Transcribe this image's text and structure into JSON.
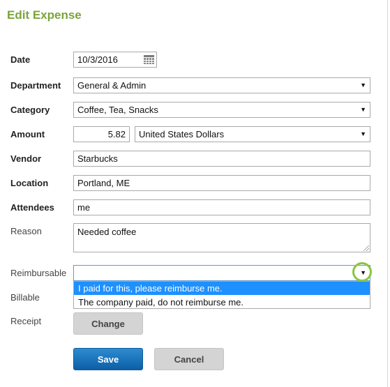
{
  "title": "Edit Expense",
  "form": {
    "date": {
      "label": "Date",
      "value": "10/3/2016",
      "icon": "calendar-icon"
    },
    "department": {
      "label": "Department",
      "value": "General & Admin"
    },
    "category": {
      "label": "Category",
      "value": "Coffee, Tea, Snacks"
    },
    "amount": {
      "label": "Amount",
      "value": "5.82",
      "currency": "United States Dollars"
    },
    "vendor": {
      "label": "Vendor",
      "value": "Starbucks"
    },
    "location": {
      "label": "Location",
      "value": "Portland, ME"
    },
    "attendees": {
      "label": "Attendees",
      "value": "me"
    },
    "reason": {
      "label": "Reason",
      "value": "Needed coffee"
    },
    "reimbursable": {
      "label": "Reimbursable",
      "value": "",
      "options": [
        "I paid for this, please reimburse me.",
        "The company paid, do not reimburse me."
      ],
      "highlight_color": "#8bc53f"
    },
    "billable": {
      "label": "Billable"
    },
    "receipt": {
      "label": "Receipt",
      "change_label": "Change"
    }
  },
  "actions": {
    "save_label": "Save",
    "cancel_label": "Cancel"
  },
  "colors": {
    "title": "#7ba33b",
    "primary": "#1a74bd",
    "selected_option": "#1e90ff"
  },
  "arrow_glyph": "▼"
}
